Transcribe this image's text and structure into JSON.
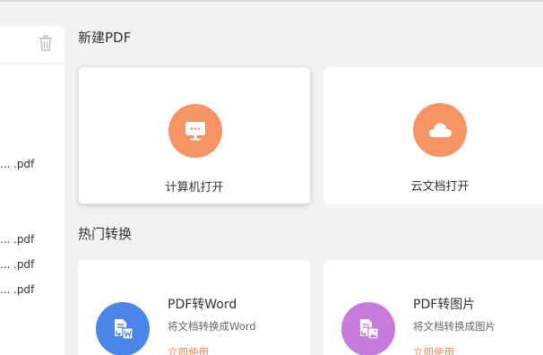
{
  "sidebar": {
    "files": [
      {
        "prefix": "...",
        "ext": ".pdf"
      },
      {
        "prefix": "...",
        "ext": ".pdf"
      },
      {
        "prefix": "...",
        "ext": ".pdf"
      },
      {
        "prefix": "...",
        "ext": ".pdf"
      }
    ]
  },
  "new_pdf": {
    "title": "新建PDF",
    "cards": [
      {
        "label": "计算机打开",
        "icon": "computer-icon",
        "color": "#f79466"
      },
      {
        "label": "云文档打开",
        "icon": "cloud-icon",
        "color": "#f79466"
      }
    ]
  },
  "popular": {
    "title": "热门转换",
    "items": [
      {
        "title": "PDF转Word",
        "desc": "将文档转换成Word",
        "action": "立即使用",
        "icon": "pdf-to-word-icon",
        "color": "#4a86e8"
      },
      {
        "title": "PDF转图片",
        "desc": "将文档转换成图片",
        "action": "立即使用",
        "icon": "pdf-to-image-icon",
        "color": "#c47ddb"
      }
    ]
  }
}
